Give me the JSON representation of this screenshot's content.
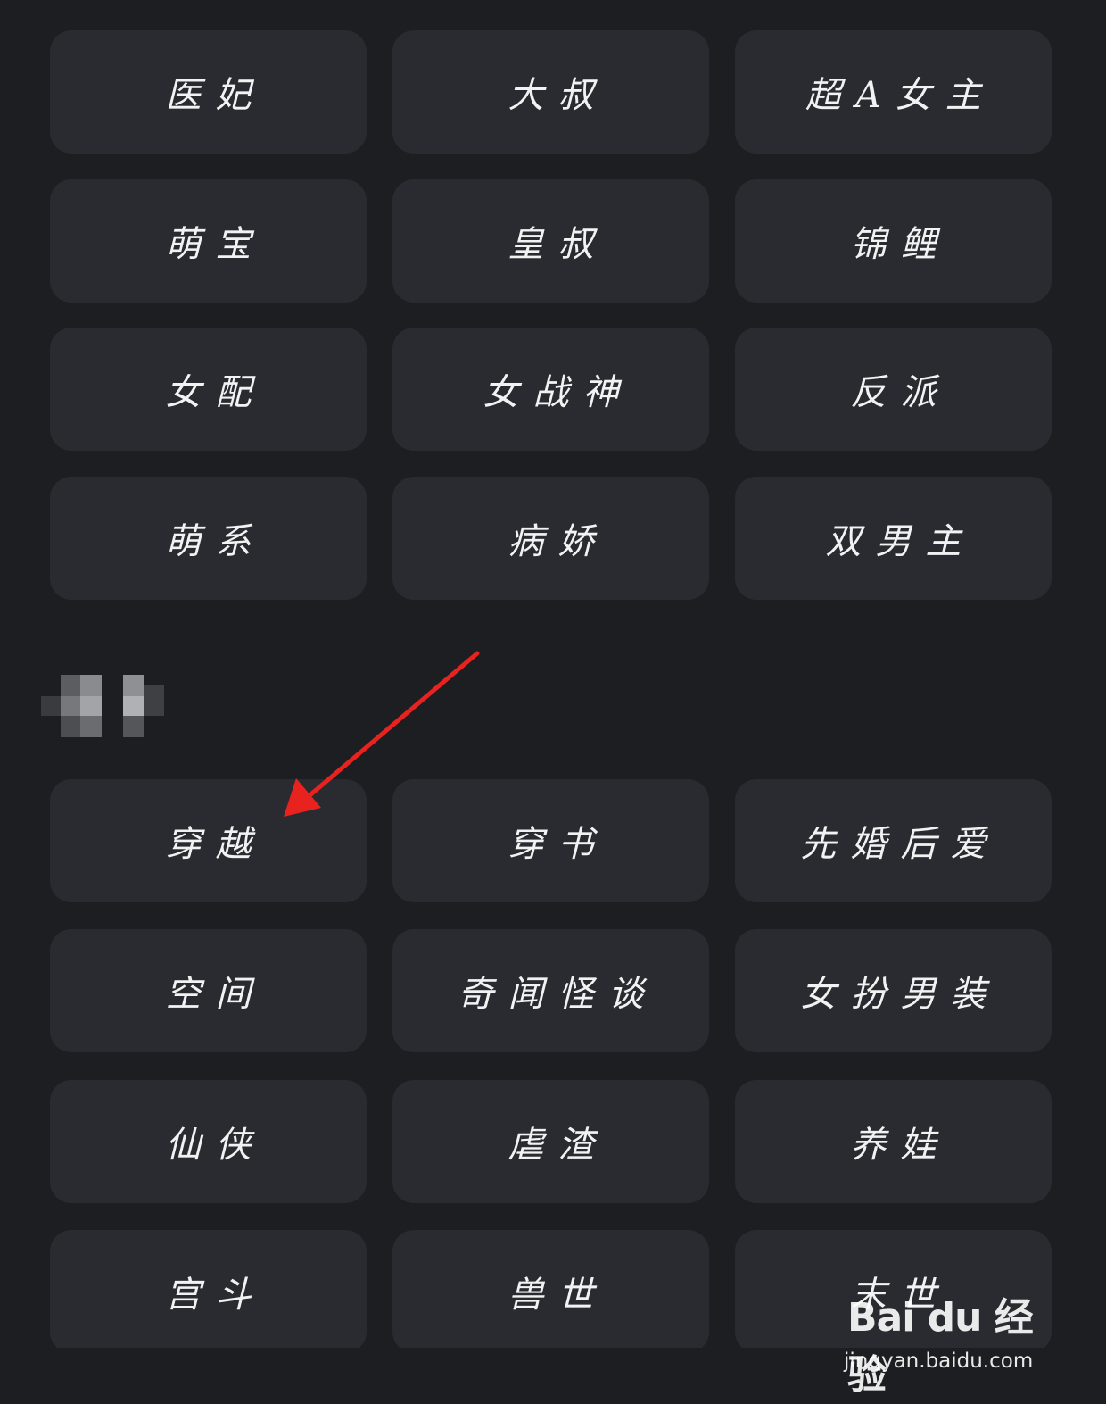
{
  "top_tags": [
    [
      "医妃",
      "大叔",
      "超A女主"
    ],
    [
      "萌宝",
      "皇叔",
      "锦鲤"
    ],
    [
      "女配",
      "女战神",
      "反派"
    ],
    [
      "萌系",
      "病娇",
      "双男主"
    ]
  ],
  "section_label": "",
  "bottom_tags": [
    [
      "穿越",
      "穿书",
      "先婚后爱"
    ],
    [
      "空间",
      "奇闻怪谈",
      "女扮男装"
    ],
    [
      "仙侠",
      "虐渣",
      "养娃"
    ],
    [
      "宫斗",
      "兽世",
      "末世"
    ]
  ],
  "annotation": {
    "arrow_color": "#e8231f",
    "points_to": "穿越"
  },
  "watermark": {
    "logo": "Bai du 经验",
    "url": "jingyan.baidu.com"
  },
  "colors": {
    "background": "#1d1e21",
    "tag_background": "#2a2b30",
    "tag_text": "#f2f2f2"
  }
}
